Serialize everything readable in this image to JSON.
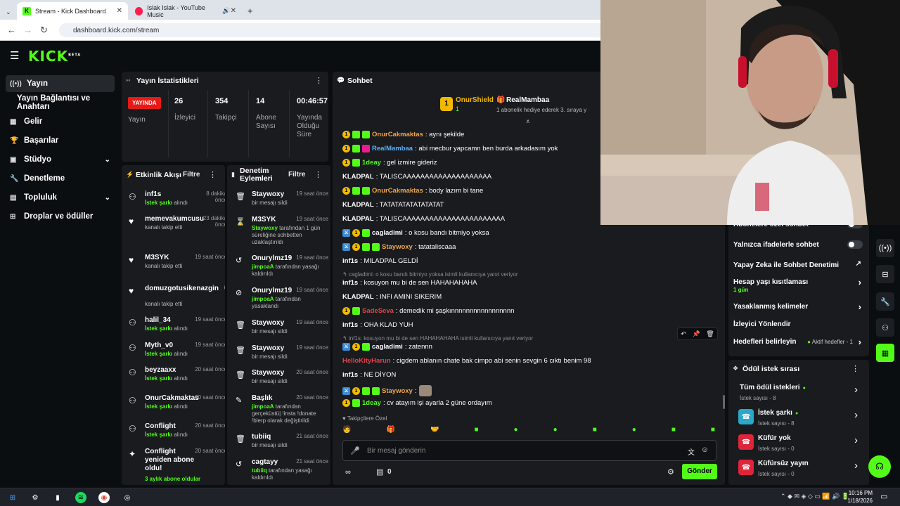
{
  "browser": {
    "tabs": [
      {
        "title": "Stream - Kick Dashboard",
        "active": true
      },
      {
        "title": "Islak Islak - YouTube Music",
        "active": false
      }
    ],
    "url": "dashboard.kick.com/stream"
  },
  "brand": {
    "logo": "KICK",
    "beta": "BETA"
  },
  "sidebar": {
    "items": [
      {
        "label": "Yayın",
        "icon": "broadcast-icon"
      },
      {
        "label": "Yayın Bağlantısı ve Anahtarı",
        "icon": ""
      },
      {
        "label": "Gelir",
        "icon": "revenue-icon"
      },
      {
        "label": "Başarılar",
        "icon": "trophy-icon"
      },
      {
        "label": "Stüdyo",
        "icon": "studio-icon"
      },
      {
        "label": "Denetleme",
        "icon": "wrench-icon"
      },
      {
        "label": "Topluluk",
        "icon": "community-icon"
      },
      {
        "label": "Droplar ve ödüller",
        "icon": "drops-icon"
      }
    ]
  },
  "stats": {
    "title": "Yayın İstatistikleri",
    "live_label": "YAYINDA",
    "live_caption": "Yayın",
    "items": [
      {
        "value": "26",
        "label": "İzleyici"
      },
      {
        "value": "354",
        "label": "Takipçi"
      },
      {
        "value": "14",
        "label": "Abone Sayısı"
      },
      {
        "value": "00:46:57",
        "label": "Yayında Olduğu Süre"
      }
    ]
  },
  "activity": {
    "title": "Etkinlik Akışı",
    "filter": "Filtre",
    "rows": [
      {
        "name": "inf1s",
        "time": "8 dakika önce",
        "sub_green": "İstek şarkı",
        "sub": " alındı"
      },
      {
        "name": "memevakumcusu",
        "time": "23 dakika önce",
        "sub_green": "",
        "sub": "kanalı takip etti"
      },
      {
        "name": "M3SYK",
        "time": "19 saat önce",
        "sub_green": "",
        "sub": "kanalı takip etti"
      },
      {
        "name": "domuzgotusikenazgin",
        "time": "6",
        "sub_green": "",
        "sub": "kanalı takip etti"
      },
      {
        "name": "halil_34",
        "time": "19 saat önce",
        "sub_green": "İstek şarkı",
        "sub": " alındı"
      },
      {
        "name": "Myth_v0",
        "time": "19 saat önce",
        "sub_green": "İstek şarkı",
        "sub": " alındı"
      },
      {
        "name": "beyzaaxx",
        "time": "20 saat önce",
        "sub_green": "İstek şarkı",
        "sub": " alındı"
      },
      {
        "name": "OnurCakmaktas",
        "time": "20 saat önce",
        "sub_green": "İstek şarkı",
        "sub": " alındı"
      },
      {
        "name": "Conflight",
        "time": "20 saat önce",
        "sub_green": "İstek şarkı",
        "sub": " alındı"
      },
      {
        "name": "Conflight yeniden abone oldu!",
        "time": "20 saat önce",
        "sub_green": "3 aylık abone oldular",
        "sub": ""
      }
    ]
  },
  "moderation": {
    "title": "Denetim Eylemleri",
    "filter": "Filtre",
    "rows": [
      {
        "name": "Staywoxy",
        "time": "19 saat önce",
        "sub_green": "",
        "sub": "bir mesajı sildi"
      },
      {
        "name": "M3SYK",
        "time": "19 saat önce",
        "sub_green": "Staywoxy",
        "sub": " tarafından 1 gün süreliğine sohbetten uzaklaştırıldı"
      },
      {
        "name": "Onurylmz19",
        "time": "19 saat önce",
        "sub_green": "jimpoaA",
        "sub": " tarafından yasağı kaldırıldı"
      },
      {
        "name": "Onurylmz19",
        "time": "19 saat önce",
        "sub_green": "jimpoaA",
        "sub": " tarafından yasaklandı"
      },
      {
        "name": "Staywoxy",
        "time": "19 saat önce",
        "sub_green": "",
        "sub": "bir mesajı sildi"
      },
      {
        "name": "Staywoxy",
        "time": "19 saat önce",
        "sub_green": "",
        "sub": "bir mesajı sildi"
      },
      {
        "name": "Staywoxy",
        "time": "20 saat önce",
        "sub_green": "",
        "sub": "bir mesajı sildi"
      },
      {
        "name": "Başlık",
        "time": "20 saat önce",
        "sub_green": "jimpoaA",
        "sub": " tarafından gerçeküstü| !insta !donate !blerp olarak değiştirildi"
      },
      {
        "name": "tubiiq",
        "time": "21 saat önce",
        "sub_green": "",
        "sub": "bir mesajı sildi"
      },
      {
        "name": "cagtayy",
        "time": "21 saat önce",
        "sub_green": "tubiiq",
        "sub": " tarafından yasağı kaldırıldı"
      }
    ]
  },
  "chat": {
    "title": "Sohbet",
    "pinned": {
      "user1": "OnurShield",
      "user1_sub": "1",
      "user2": "RealMambaa",
      "user2_sub": "1 abonelik hediye ederek 3. sıraya y"
    },
    "messages": [
      {
        "user": "OnurCakmaktas",
        "color": "#f2a64a",
        "badges": [
          "gold",
          "green",
          "green"
        ],
        "text": ": aynı şekilde"
      },
      {
        "user": "RealMambaa",
        "color": "#5eb3ff",
        "badges": [
          "gold",
          "green",
          "pink"
        ],
        "text": ": abi mecbur yapcamn ben burda arkadasım yok"
      },
      {
        "user": "1deay",
        "color": "#53fc18",
        "badges": [
          "gold",
          "green"
        ],
        "text": ": gel izmire gideriz"
      },
      {
        "user": "KLADPAL",
        "color": "#ffffff",
        "badges": [],
        "text": ": TALISCAAAAAAAAAAAAAAAAAAAA"
      },
      {
        "user": "OnurCakmaktas",
        "color": "#f2a64a",
        "badges": [
          "gold",
          "green",
          "green"
        ],
        "text": ": body lazım bi tane"
      },
      {
        "user": "KLADPAL",
        "color": "#ffffff",
        "badges": [],
        "text": ": TATATATATATATATAT"
      },
      {
        "user": "KLADPAL",
        "color": "#ffffff",
        "badges": [],
        "text": ": TALISCAAAAAAAAAAAAAAAAAAAAAAA"
      },
      {
        "user": "cagladimi",
        "color": "#ffffff",
        "badges": [
          "blue",
          "gold",
          "green"
        ],
        "text": ": o kosu bandı bitmiyo yoksa"
      },
      {
        "user": "Staywoxy",
        "color": "#f2a64a",
        "badges": [
          "blue",
          "gold",
          "green",
          "green"
        ],
        "text": ": tatataliscaaa"
      },
      {
        "user": "inf1s",
        "color": "#ffffff",
        "badges": [],
        "text": ": MILADPAL GELDİ"
      },
      {
        "user": "inf1s",
        "color": "#ffffff",
        "badges": [],
        "text": ": kosuyon mu bi de sen HAHAHAHAHA",
        "reply": "cagladimi: o kosu bandı bitmiyo yoksa isimli kullanıcıya yanıt veriyor"
      },
      {
        "user": "KLADPAL",
        "color": "#ffffff",
        "badges": [],
        "text": ": INFI AMINI SIKERIM"
      },
      {
        "user": "SadeSeva",
        "color": "#e0454a",
        "badges": [
          "gold",
          "green"
        ],
        "text": ": demedik mi şaşkınnnnnnnnnnnnnnnnn"
      },
      {
        "user": "inf1s",
        "color": "#ffffff",
        "badges": [],
        "text": ": OHA KLAD YUH"
      },
      {
        "user": "cagladimi",
        "color": "#ffffff",
        "badges": [
          "blue",
          "gold",
          "green"
        ],
        "text": ": zatennn",
        "reply": "inf1s: kosuyon mu bi de sen HAHAHAHAHA isimli kullanıcıya yanıt veriyor"
      },
      {
        "user": "HelloKityHarun",
        "color": "#e0454a",
        "badges": [],
        "text": ": cigdem ablanın chate bak cimpo abi senin sevgin 6 cıktı benim 98"
      },
      {
        "user": "inf1s",
        "color": "#ffffff",
        "badges": [],
        "text": ": NE DİYON"
      },
      {
        "user": "Staywoxy",
        "color": "#f2a64a",
        "badges": [
          "blue",
          "gold",
          "green",
          "green"
        ],
        "text": ":"
      },
      {
        "user": "1deay",
        "color": "#53fc18",
        "badges": [
          "gold",
          "green"
        ],
        "text": ": cv atayım işi ayarla 2 güne ordayım"
      }
    ],
    "followers_label": "Takipçilere Özel",
    "input_placeholder": "Bir mesaj gönderin",
    "points": "0",
    "send_label": "Gönder"
  },
  "settings": {
    "rows": [
      {
        "label": "Abonelere özel sohbet",
        "type": "toggle"
      },
      {
        "label": "Yalnızca ifadelerle sohbet",
        "type": "toggle"
      },
      {
        "label": "Yapay Zeka ile Sohbet Denetimi",
        "type": "external"
      },
      {
        "label": "Hesap yaşı kısıtlaması",
        "type": "arrow",
        "sub": "1 gün"
      },
      {
        "label": "Yasaklanmış kelimeler",
        "type": "arrow"
      },
      {
        "label": "İzleyici Yönlendir",
        "type": "none"
      },
      {
        "label": "Hedefleri belirleyin",
        "type": "arrow",
        "extra": "Aktif hedefler - 1"
      }
    ]
  },
  "rewards": {
    "title": "Ödül istek sırası",
    "rows": [
      {
        "title": "Tüm ödül istekleri",
        "sub": "İstek sayısı - 8",
        "icon_color": ""
      },
      {
        "title": "İstek şarkı",
        "sub": "İstek sayısı - 8",
        "icon_color": "#2aa7c9"
      },
      {
        "title": "Küfür yok",
        "sub": "İstek sayısı - 0",
        "icon_color": "#e0243a"
      },
      {
        "title": "Küfürsüz yayın",
        "sub": "İstek sayısı - 0",
        "icon_color": "#e0243a"
      }
    ]
  },
  "taskbar": {
    "time": "10:16 PM",
    "date": "1/18/2026"
  },
  "colors": {
    "accent": "#53fc18",
    "live": "#e91916",
    "panel": "#191b1f",
    "background": "#0b0e11"
  }
}
